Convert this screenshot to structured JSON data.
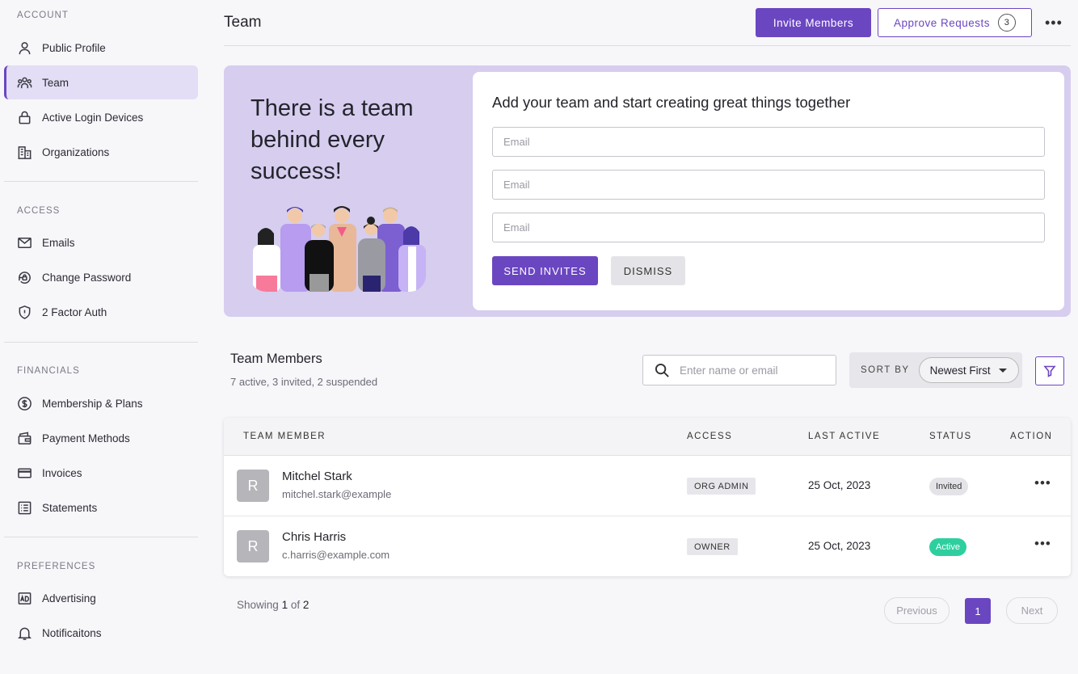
{
  "sidebar": {
    "sections": {
      "account": "ACCOUNT",
      "access": "ACCESS",
      "financials": "FINANCIALS",
      "preferences": "PREFERENCES"
    },
    "items": {
      "public_profile": {
        "label": "Public Profile",
        "icon": "user-icon"
      },
      "team": {
        "label": "Team",
        "icon": "team-icon",
        "active": true
      },
      "active_login_devices": {
        "label": "Active Login Devices",
        "icon": "lock-icon"
      },
      "organizations": {
        "label": "Organizations",
        "icon": "building-icon"
      },
      "emails": {
        "label": "Emails",
        "icon": "mail-icon"
      },
      "change_password": {
        "label": "Change Password",
        "icon": "lock-rotate-icon"
      },
      "two_factor": {
        "label": "2 Factor Auth",
        "icon": "shield-icon"
      },
      "membership": {
        "label": "Membership & Plans",
        "icon": "dollar-circle-icon"
      },
      "payment_methods": {
        "label": "Payment Methods",
        "icon": "wallet-icon"
      },
      "invoices": {
        "label": "Invoices",
        "icon": "card-icon"
      },
      "statements": {
        "label": "Statements",
        "icon": "list-icon"
      },
      "advertising": {
        "label": "Advertising",
        "icon": "ad-icon"
      },
      "notifications": {
        "label": "Notificaitons",
        "icon": "bell-icon"
      }
    }
  },
  "header": {
    "title": "Team",
    "invite_label": "Invite Members",
    "approve_label": "Approve Requests",
    "approve_count": "3",
    "more": "•••"
  },
  "banner": {
    "title": "There is a team behind every success!",
    "form_title": "Add your team and start creating great things together",
    "email_placeholder": "Email",
    "send_label": "SEND INVITES",
    "dismiss_label": "DISMISS"
  },
  "members": {
    "title": "Team Members",
    "subtitle": "7 active, 3 invited, 2 suspended",
    "search_placeholder": "Enter name or email",
    "sort_label": "SORT BY",
    "sort_value": "Newest First",
    "columns": {
      "member": "TEAM MEMBER",
      "access": "ACCESS",
      "last_active": "LAST ACTIVE",
      "status": "STATUS",
      "action": "ACTION"
    },
    "rows": [
      {
        "initial": "R",
        "name": "Mitchel Stark",
        "email": "mitchel.stark@example",
        "access": "ORG ADMIN",
        "last_active": "25 Oct, 2023",
        "status": "Invited"
      },
      {
        "initial": "R",
        "name": "Chris Harris",
        "email": "c.harris@example.com",
        "access": "OWNER",
        "last_active": "25 Oct, 2023",
        "status": "Active"
      }
    ]
  },
  "pagination": {
    "showing_prefix": "Showing",
    "current": "1",
    "of": "of",
    "total": "2",
    "previous": "Previous",
    "page": "1",
    "next": "Next"
  },
  "colors": {
    "accent": "#6b46c1",
    "banner_bg": "#d6cdef",
    "active_status": "#2ecf9f"
  }
}
